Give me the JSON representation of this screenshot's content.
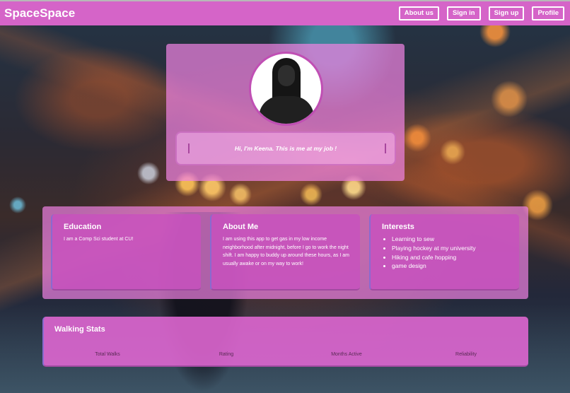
{
  "brand": "SpaceSpace",
  "nav": {
    "about_us": "About us",
    "sign_in": "Sign in",
    "sign_up": "Sign up",
    "profile": "Profile"
  },
  "profile": {
    "bio": "Hi, I'm Keena. This is me at my job !"
  },
  "education": {
    "title": "Education",
    "text": "I am a Comp Sci student at CU!"
  },
  "about": {
    "title": "About Me",
    "text": "I am using this app to get gas in my low income neighborhood after midnight, before I go to work the night shift. I am happy to buddy up around these hours, as I am usually awake or on my way to work!"
  },
  "interests": {
    "title": "Interests",
    "items": [
      "Learning to sew",
      "Playing hockey at my university",
      "Hiking and cafe hopping",
      "game design"
    ]
  },
  "stats": {
    "title": "Walking Stats",
    "labels": [
      "Total Walks",
      "Rating",
      "Months Active",
      "Reliability"
    ]
  },
  "colors": {
    "navbar": "#d564c8",
    "card": "#ee82e1",
    "inner_card": "#c850be",
    "accent_border": "#8a6ad0"
  }
}
